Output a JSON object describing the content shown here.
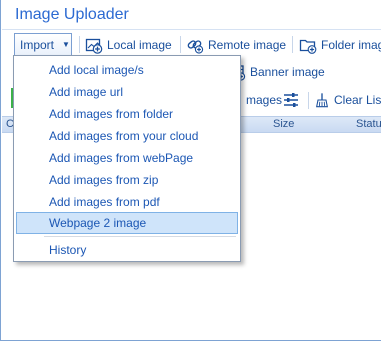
{
  "app": {
    "title": "Image Uploader"
  },
  "toolbar": {
    "import_label": "Import",
    "local_image_label": "Local image",
    "remote_image_label": "Remote image",
    "folder_image_label": "Folder imag"
  },
  "toolbar_row2": {
    "banner_image_label": "Banner image"
  },
  "toolbar_row3": {
    "images_label": "mages",
    "clear_list_label": "Clear List"
  },
  "grid": {
    "columns": [
      "C",
      "Size",
      "Statu"
    ]
  },
  "menu": {
    "items": [
      {
        "label": "Add local image/s"
      },
      {
        "label": "Add image url"
      },
      {
        "label": "Add images from folder"
      },
      {
        "label": "Add images from your cloud"
      },
      {
        "label": "Add images from webPage"
      },
      {
        "label": "Add images from zip"
      },
      {
        "label": "Add images from pdf"
      },
      {
        "label": "Webpage 2 image"
      },
      {
        "label": "History"
      }
    ],
    "selected_index": 7
  },
  "colors": {
    "accent": "#2c6ad2",
    "menu_text": "#1c57b4",
    "selected_bg": "#cfe4fa"
  }
}
